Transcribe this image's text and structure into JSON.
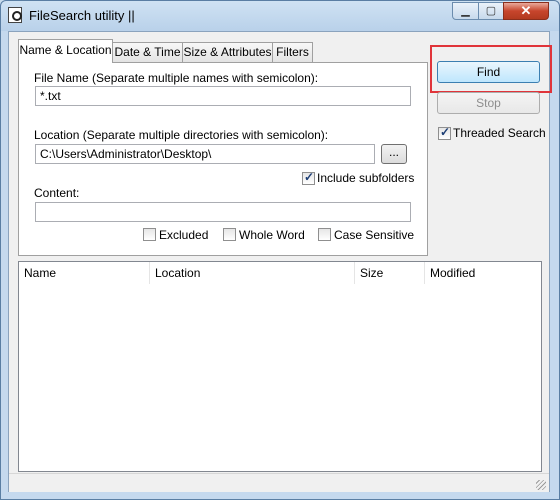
{
  "window": {
    "title": "FileSearch utility || ",
    "min": "▁",
    "max": "▢",
    "close": "✕"
  },
  "tabs": [
    "Name & Location",
    "Date & Time",
    "Size & Attributes",
    "Filters"
  ],
  "form": {
    "filename_label": "File Name (Separate multiple names with semicolon):",
    "filename_value": "*.txt",
    "location_label": "Location (Separate multiple directories with semicolon):",
    "location_value": "C:\\Users\\Administrator\\Desktop\\",
    "browse_label": "...",
    "include_subfolders_label": "Include subfolders",
    "include_subfolders_checked": true,
    "content_label": "Content:",
    "content_value": "",
    "excluded_label": "Excluded",
    "whole_word_label": "Whole Word",
    "case_sensitive_label": "Case Sensitive"
  },
  "actions": {
    "find_label": "Find",
    "stop_label": "Stop",
    "threaded_label": "Threaded Search",
    "threaded_checked": true
  },
  "results": {
    "columns": [
      "Name",
      "Location",
      "Size",
      "Modified"
    ],
    "rows": []
  },
  "colors": {
    "highlight": "#e0343a",
    "close_button": "#c7452c"
  }
}
